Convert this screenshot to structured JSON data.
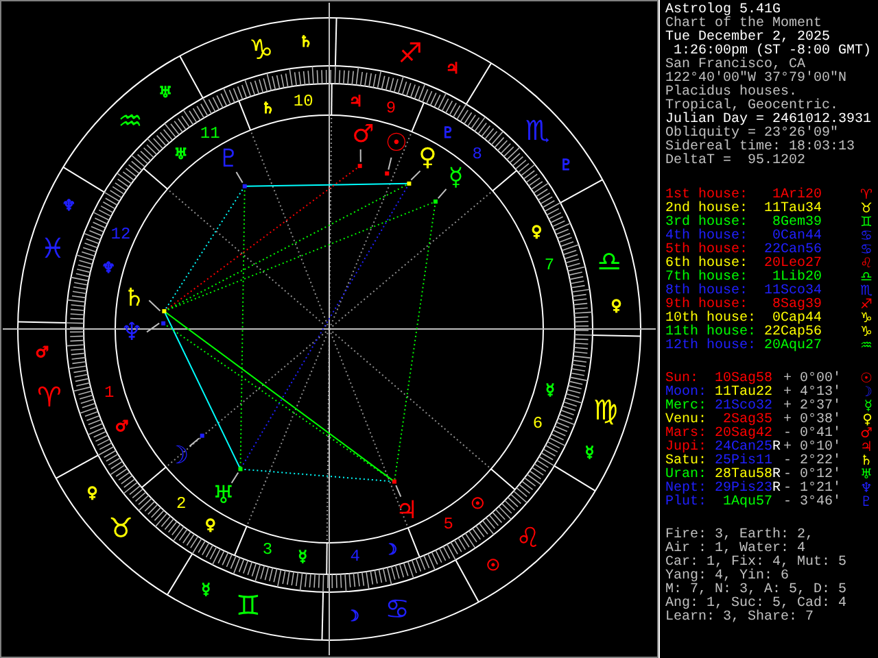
{
  "header": [
    {
      "text": "Astrolog 5.41G",
      "bright": true
    },
    {
      "text": "Chart of the Moment",
      "bright": false
    },
    {
      "text": "Tue December 2, 2025",
      "bright": true
    },
    {
      "text": " 1:26:00pm (ST -8:00 GMT)",
      "bright": true
    },
    {
      "text": "San Francisco, CA",
      "bright": false
    },
    {
      "text": "122°40'00\"W 37°79'00\"N",
      "bright": false
    },
    {
      "text": "Placidus houses.",
      "bright": false
    },
    {
      "text": "Tropical, Geocentric.",
      "bright": false
    },
    {
      "text": "Julian Day = 2461012.3931",
      "bright": true
    },
    {
      "text": "Obliquity = 23°26'09\"",
      "bright": false
    },
    {
      "text": "Sidereal time: 18:03:13",
      "bright": false
    },
    {
      "text": "DeltaT =  95.1202",
      "bright": false
    }
  ],
  "houses": [
    {
      "label": "1st house:",
      "color": "#ff0000",
      "position": {
        "text": "1Ari20",
        "color": "#ff0000"
      },
      "sign": {
        "glyph": "♈",
        "color": "#ff0000"
      }
    },
    {
      "label": "2nd house:",
      "color": "#ffff00",
      "position": {
        "text": "11Tau34",
        "color": "#ffff00"
      },
      "sign": {
        "glyph": "♉",
        "color": "#ffff00"
      }
    },
    {
      "label": "3rd house:",
      "color": "#00ff00",
      "position": {
        "text": "8Gem39",
        "color": "#00ff00"
      },
      "sign": {
        "glyph": "♊",
        "color": "#00ff00"
      }
    },
    {
      "label": "4th house:",
      "color": "#2020ff",
      "position": {
        "text": "0Can44",
        "color": "#2020ff"
      },
      "sign": {
        "glyph": "♋",
        "color": "#2020ff"
      }
    },
    {
      "label": "5th house:",
      "color": "#ff0000",
      "position": {
        "text": "22Can56",
        "color": "#2020ff"
      },
      "sign": {
        "glyph": "♋",
        "color": "#2020ff"
      }
    },
    {
      "label": "6th house:",
      "color": "#ffff00",
      "position": {
        "text": "20Leo27",
        "color": "#ff0000"
      },
      "sign": {
        "glyph": "♌",
        "color": "#ff0000"
      }
    },
    {
      "label": "7th house:",
      "color": "#00ff00",
      "position": {
        "text": "1Lib20",
        "color": "#00ff00"
      },
      "sign": {
        "glyph": "♎",
        "color": "#00ff00"
      }
    },
    {
      "label": "8th house:",
      "color": "#2020ff",
      "position": {
        "text": "11Sco34",
        "color": "#2020ff"
      },
      "sign": {
        "glyph": "♏",
        "color": "#2020ff"
      }
    },
    {
      "label": "9th house:",
      "color": "#ff0000",
      "position": {
        "text": "8Sag39",
        "color": "#ff0000"
      },
      "sign": {
        "glyph": "♐",
        "color": "#ff0000"
      }
    },
    {
      "label": "10th house:",
      "color": "#ffff00",
      "position": {
        "text": "0Cap44",
        "color": "#ffff00"
      },
      "sign": {
        "glyph": "♑",
        "color": "#ffff00"
      }
    },
    {
      "label": "11th house:",
      "color": "#00ff00",
      "position": {
        "text": "22Cap56",
        "color": "#ffff00"
      },
      "sign": {
        "glyph": "♑",
        "color": "#ffff00"
      }
    },
    {
      "label": "12th house:",
      "color": "#2020ff",
      "position": {
        "text": "20Aqu27",
        "color": "#00ff00"
      },
      "sign": {
        "glyph": "♒",
        "color": "#00ff00"
      }
    }
  ],
  "planets": [
    {
      "name": "Sun:",
      "color": "#ff0000",
      "position": {
        "text": "10Sag58",
        "color": "#ff0000"
      },
      "latitude": "+ 0°00'",
      "glyph": "☉"
    },
    {
      "name": "Moon:",
      "color": "#2020ff",
      "position": {
        "text": "11Tau22",
        "color": "#ffff00"
      },
      "latitude": "+ 4°13'",
      "glyph": "☽"
    },
    {
      "name": "Merc:",
      "color": "#00ff00",
      "position": {
        "text": "21Sco32",
        "color": "#2020ff"
      },
      "latitude": "+ 2°37'",
      "glyph": "☿"
    },
    {
      "name": "Venu:",
      "color": "#ffff00",
      "position": {
        "text": "2Sag35",
        "color": "#ff0000"
      },
      "latitude": "+ 0°38'",
      "glyph": "♀"
    },
    {
      "name": "Mars:",
      "color": "#ff0000",
      "position": {
        "text": "20Sag42",
        "color": "#ff0000"
      },
      "latitude": "- 0°41'",
      "glyph": "♂"
    },
    {
      "name": "Jupi:",
      "color": "#ff0000",
      "position": {
        "text": "24Can25",
        "color": "#2020ff"
      },
      "flag": "R",
      "latitude": "+ 0°10'",
      "glyph": "♃"
    },
    {
      "name": "Satu:",
      "color": "#ffff00",
      "position": {
        "text": "25Pis11",
        "color": "#2020ff"
      },
      "latitude": "- 2°22'",
      "glyph": "♄"
    },
    {
      "name": "Uran:",
      "color": "#00ff00",
      "position": {
        "text": "28Tau58",
        "color": "#ffff00"
      },
      "flag": "R",
      "latitude": "- 0°12'",
      "glyph": "♅"
    },
    {
      "name": "Nept:",
      "color": "#2020ff",
      "position": {
        "text": "29Pis23",
        "color": "#2020ff"
      },
      "flag": "R",
      "latitude": "- 1°21'",
      "glyph": "♆"
    },
    {
      "name": "Plut:",
      "color": "#2020ff",
      "position": {
        "text": "1Aqu57",
        "color": "#00ff00"
      },
      "latitude": "- 3°46'",
      "glyph": "♇"
    }
  ],
  "stats": [
    "Fire: 3, Earth: 2,",
    "Air : 1, Water: 4",
    "Car: 1, Fix: 4, Mut: 5",
    "Yang: 4, Yin: 6",
    "M: 7, N: 3, A: 5, D: 5",
    "Ang: 1, Suc: 5, Cad: 4",
    "Learn: 3, Share: 7"
  ],
  "wheel": {
    "signs": [
      {
        "glyph": "♑",
        "color": "#ffff00",
        "ruler": {
          "glyph": "♄",
          "color": "#ffff00"
        }
      },
      {
        "glyph": "♐",
        "color": "#ff0000",
        "ruler": {
          "glyph": "♃",
          "color": "#ff0000"
        }
      },
      {
        "glyph": "♒",
        "color": "#00ff00",
        "ruler": {
          "glyph": "♅",
          "color": "#00ff00"
        }
      },
      {
        "glyph": "♏",
        "color": "#2020ff",
        "ruler": {
          "glyph": "♇",
          "color": "#2020ff"
        }
      },
      {
        "glyph": "♓",
        "color": "#2020ff",
        "ruler": {
          "glyph": "♆",
          "color": "#2020ff"
        }
      },
      {
        "glyph": "♎",
        "color": "#00ff00",
        "ruler": {
          "glyph": "♀",
          "color": "#ffff00"
        }
      },
      {
        "glyph": "♈",
        "color": "#ff0000",
        "ruler": {
          "glyph": "♂",
          "color": "#ff0000"
        }
      },
      {
        "glyph": "♍",
        "color": "#ffff00",
        "ruler": {
          "glyph": "☿",
          "color": "#00ff00"
        }
      },
      {
        "glyph": "♉",
        "color": "#ffff00",
        "ruler": {
          "glyph": "♀",
          "color": "#ffff00"
        }
      },
      {
        "glyph": "♌",
        "color": "#ff0000",
        "ruler": {
          "glyph": "☉",
          "color": "#ff0000"
        }
      },
      {
        "glyph": "♊",
        "color": "#00ff00",
        "ruler": {
          "glyph": "☿",
          "color": "#00ff00"
        }
      },
      {
        "glyph": "♋",
        "color": "#2020ff",
        "ruler": {
          "glyph": "☽",
          "color": "#2020ff"
        }
      }
    ],
    "houses": [
      {
        "number": "1",
        "color": "#ff0000",
        "ruler": {
          "glyph": "♂",
          "color": "#ff0000"
        }
      },
      {
        "number": "2",
        "color": "#ffff00",
        "ruler": {
          "glyph": "♀",
          "color": "#ffff00"
        }
      },
      {
        "number": "3",
        "color": "#00ff00",
        "ruler": {
          "glyph": "☿",
          "color": "#00ff00"
        }
      },
      {
        "number": "4",
        "color": "#2020ff",
        "ruler": {
          "glyph": "☽",
          "color": "#2020ff"
        }
      },
      {
        "number": "5",
        "color": "#ff0000",
        "ruler": {
          "glyph": "☉",
          "color": "#ff0000"
        }
      },
      {
        "number": "6",
        "color": "#ffff00",
        "ruler": {
          "glyph": "☿",
          "color": "#00ff00"
        }
      },
      {
        "number": "7",
        "color": "#00ff00",
        "ruler": {
          "glyph": "♀",
          "color": "#ffff00"
        }
      },
      {
        "number": "8",
        "color": "#2020ff",
        "ruler": {
          "glyph": "♇",
          "color": "#2020ff"
        }
      },
      {
        "number": "9",
        "color": "#ff0000",
        "ruler": {
          "glyph": "♃",
          "color": "#ff0000"
        }
      },
      {
        "number": "10",
        "color": "#ffff00",
        "ruler": {
          "glyph": "♄",
          "color": "#ffff00"
        }
      },
      {
        "number": "11",
        "color": "#00ff00",
        "ruler": {
          "glyph": "♅",
          "color": "#00ff00"
        }
      },
      {
        "number": "12",
        "color": "#2020ff",
        "ruler": {
          "glyph": "♆",
          "color": "#2020ff"
        }
      }
    ],
    "planets": [
      {
        "glyph": "☉",
        "color": "#ff0000"
      },
      {
        "glyph": "☽",
        "color": "#2020ff"
      },
      {
        "glyph": "☿",
        "color": "#00ff00"
      },
      {
        "glyph": "♀",
        "color": "#ffff00"
      },
      {
        "glyph": "♂",
        "color": "#ff0000"
      },
      {
        "glyph": "♃",
        "color": "#ff0000"
      },
      {
        "glyph": "♄",
        "color": "#ffff00"
      },
      {
        "glyph": "♅",
        "color": "#00ff00"
      },
      {
        "glyph": "♆",
        "color": "#2020ff"
      },
      {
        "glyph": "♇",
        "color": "#2020ff"
      }
    ]
  }
}
